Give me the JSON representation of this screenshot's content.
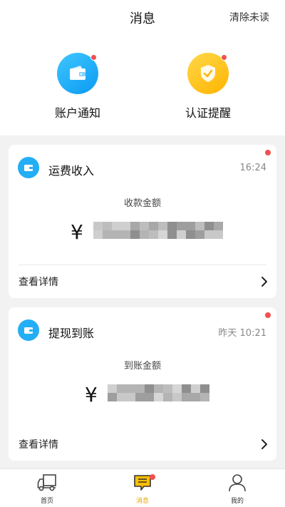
{
  "header": {
    "title": "消息",
    "clear_label": "清除未读"
  },
  "categories": [
    {
      "label": "账户通知",
      "icon": "wallet-icon",
      "color": "#1aa3f5",
      "unread": true
    },
    {
      "label": "认证提醒",
      "icon": "shield-check-icon",
      "color": "#ffbf00",
      "unread": true
    }
  ],
  "messages": [
    {
      "title": "运费收入",
      "time": "16:24",
      "amount_label": "收款金额",
      "currency": "¥",
      "detail_label": "查看详情",
      "unread": true
    },
    {
      "title": "提现到账",
      "time": "昨天 10:21",
      "amount_label": "到账金额",
      "currency": "¥",
      "detail_label": "查看详情",
      "unread": true
    }
  ],
  "tabbar": {
    "items": [
      {
        "label": "首页",
        "icon": "truck-icon",
        "active": false
      },
      {
        "label": "消息",
        "icon": "message-icon",
        "active": true
      },
      {
        "label": "我的",
        "icon": "user-icon",
        "active": false
      }
    ]
  },
  "colors": {
    "accent": "#ffbf00",
    "badge": "#f05050",
    "blue": "#1aa3f5"
  }
}
